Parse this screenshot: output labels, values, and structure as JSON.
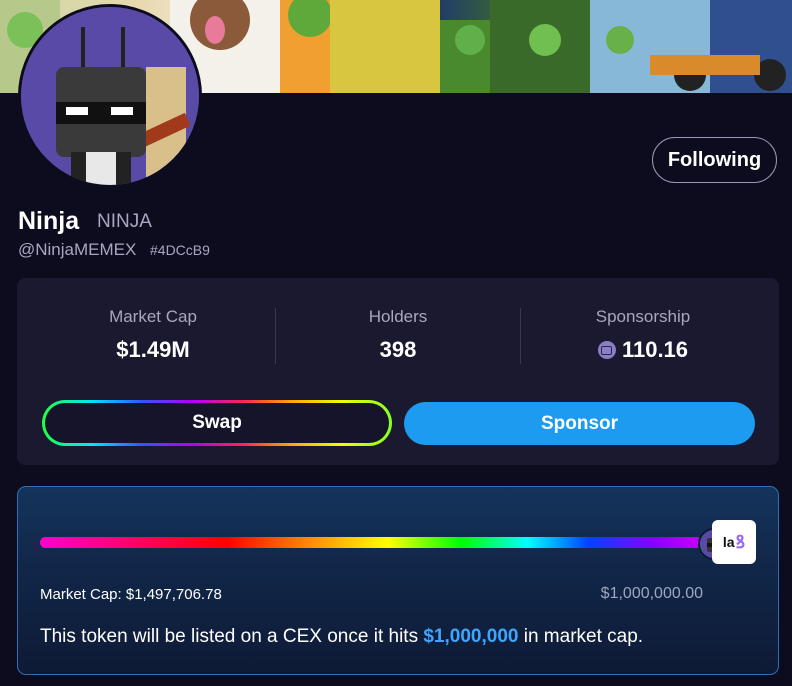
{
  "profile": {
    "name": "Ninja",
    "ticker": "NINJA",
    "handle": "@NinjaMEMEX",
    "address": "#4DCcB9",
    "follow_label": "Following"
  },
  "stats": {
    "market_cap_label": "Market Cap",
    "market_cap_value": "$1.49M",
    "holders_label": "Holders",
    "holders_value": "398",
    "sponsorship_label": "Sponsorship",
    "sponsorship_value": "110.16",
    "sponsorship_icon": "tv-coin-icon"
  },
  "actions": {
    "swap_label": "Swap",
    "sponsor_label": "Sponsor"
  },
  "progress": {
    "current_label": "Market Cap: $1,497,706.78",
    "target_label": "$1,000,000.00",
    "fill_fraction": 1.0,
    "end_logo_text": "la",
    "cex_text_before": "This token will be listed on a CEX once it hits ",
    "cex_text_highlight": "$1,000,000",
    "cex_text_after": " in market cap."
  },
  "colors": {
    "background": "#0d0c1f",
    "card": "#1a1930",
    "accent_blue": "#1d9bf0",
    "highlight_blue": "#3ea6ff",
    "muted_text": "#a8a7bf"
  }
}
